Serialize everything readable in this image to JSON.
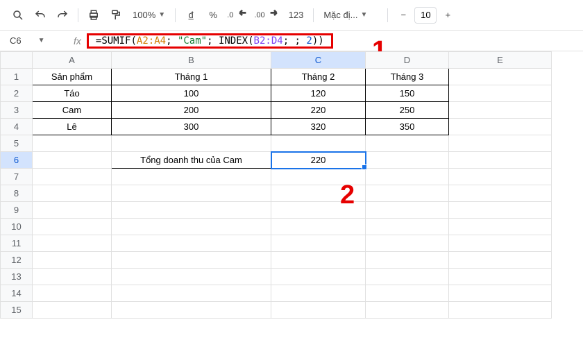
{
  "toolbar": {
    "zoom": "100%",
    "currency": "đ",
    "percent": "%",
    "dec_dec": ".0",
    "inc_dec": ".00",
    "num_fmt": "123",
    "font": "Mặc đị...",
    "minus": "−",
    "font_size": "10",
    "plus": "+"
  },
  "namebox": {
    "cell": "C6"
  },
  "formula": {
    "eq": "=",
    "fn1": "SUMIF",
    "op": "(",
    "r1": "A2:A4",
    "sep1": "; ",
    "str": "\"Cam\"",
    "sep2": "; ",
    "fn2": "INDEX",
    "op2": "(",
    "r2": "B2:D4",
    "sep3": "; ; ",
    "num": "2",
    "close": "))"
  },
  "anno": {
    "one": "1",
    "two": "2"
  },
  "cols": [
    "A",
    "B",
    "C",
    "D",
    "E"
  ],
  "rows": [
    "1",
    "2",
    "3",
    "4",
    "5",
    "6",
    "7",
    "8",
    "9",
    "10",
    "11",
    "12",
    "13",
    "14",
    "15"
  ],
  "table": {
    "h": [
      "Sản phẩm",
      "Tháng 1",
      "Tháng 2",
      "Tháng 3"
    ],
    "r2": [
      "Táo",
      "100",
      "120",
      "150"
    ],
    "r3": [
      "Cam",
      "200",
      "220",
      "250"
    ],
    "r4": [
      "Lê",
      "300",
      "320",
      "350"
    ]
  },
  "summary": {
    "label": "Tổng doanh thu của Cam",
    "value": "220"
  },
  "chart_data": {
    "type": "table",
    "columns": [
      "Sản phẩm",
      "Tháng 1",
      "Tháng 2",
      "Tháng 3"
    ],
    "rows": [
      [
        "Táo",
        100,
        120,
        150
      ],
      [
        "Cam",
        200,
        220,
        250
      ],
      [
        "Lê",
        300,
        320,
        350
      ]
    ],
    "computed": {
      "label": "Tổng doanh thu của Cam",
      "formula": "=SUMIF(A2:A4; \"Cam\"; INDEX(B2:D4; ; 2))",
      "result": 220
    }
  }
}
